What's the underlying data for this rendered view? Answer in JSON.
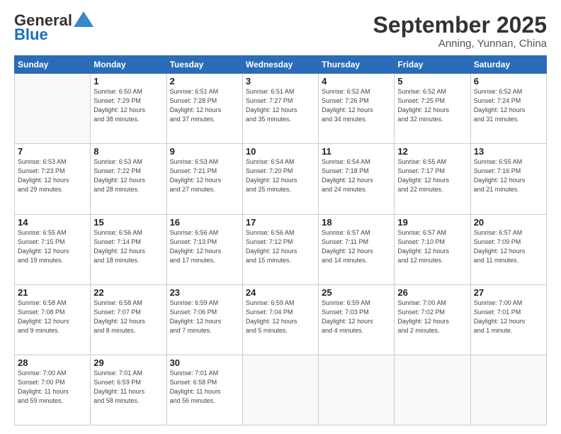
{
  "header": {
    "logo_general": "General",
    "logo_blue": "Blue",
    "month_title": "September 2025",
    "location": "Anning, Yunnan, China"
  },
  "weekdays": [
    "Sunday",
    "Monday",
    "Tuesday",
    "Wednesday",
    "Thursday",
    "Friday",
    "Saturday"
  ],
  "weeks": [
    [
      {
        "day": "",
        "info": ""
      },
      {
        "day": "1",
        "info": "Sunrise: 6:50 AM\nSunset: 7:29 PM\nDaylight: 12 hours\nand 38 minutes."
      },
      {
        "day": "2",
        "info": "Sunrise: 6:51 AM\nSunset: 7:28 PM\nDaylight: 12 hours\nand 37 minutes."
      },
      {
        "day": "3",
        "info": "Sunrise: 6:51 AM\nSunset: 7:27 PM\nDaylight: 12 hours\nand 35 minutes."
      },
      {
        "day": "4",
        "info": "Sunrise: 6:52 AM\nSunset: 7:26 PM\nDaylight: 12 hours\nand 34 minutes."
      },
      {
        "day": "5",
        "info": "Sunrise: 6:52 AM\nSunset: 7:25 PM\nDaylight: 12 hours\nand 32 minutes."
      },
      {
        "day": "6",
        "info": "Sunrise: 6:52 AM\nSunset: 7:24 PM\nDaylight: 12 hours\nand 31 minutes."
      }
    ],
    [
      {
        "day": "7",
        "info": "Sunrise: 6:53 AM\nSunset: 7:23 PM\nDaylight: 12 hours\nand 29 minutes."
      },
      {
        "day": "8",
        "info": "Sunrise: 6:53 AM\nSunset: 7:22 PM\nDaylight: 12 hours\nand 28 minutes."
      },
      {
        "day": "9",
        "info": "Sunrise: 6:53 AM\nSunset: 7:21 PM\nDaylight: 12 hours\nand 27 minutes."
      },
      {
        "day": "10",
        "info": "Sunrise: 6:54 AM\nSunset: 7:20 PM\nDaylight: 12 hours\nand 25 minutes."
      },
      {
        "day": "11",
        "info": "Sunrise: 6:54 AM\nSunset: 7:18 PM\nDaylight: 12 hours\nand 24 minutes."
      },
      {
        "day": "12",
        "info": "Sunrise: 6:55 AM\nSunset: 7:17 PM\nDaylight: 12 hours\nand 22 minutes."
      },
      {
        "day": "13",
        "info": "Sunrise: 6:55 AM\nSunset: 7:16 PM\nDaylight: 12 hours\nand 21 minutes."
      }
    ],
    [
      {
        "day": "14",
        "info": "Sunrise: 6:55 AM\nSunset: 7:15 PM\nDaylight: 12 hours\nand 19 minutes."
      },
      {
        "day": "15",
        "info": "Sunrise: 6:56 AM\nSunset: 7:14 PM\nDaylight: 12 hours\nand 18 minutes."
      },
      {
        "day": "16",
        "info": "Sunrise: 6:56 AM\nSunset: 7:13 PM\nDaylight: 12 hours\nand 17 minutes."
      },
      {
        "day": "17",
        "info": "Sunrise: 6:56 AM\nSunset: 7:12 PM\nDaylight: 12 hours\nand 15 minutes."
      },
      {
        "day": "18",
        "info": "Sunrise: 6:57 AM\nSunset: 7:11 PM\nDaylight: 12 hours\nand 14 minutes."
      },
      {
        "day": "19",
        "info": "Sunrise: 6:57 AM\nSunset: 7:10 PM\nDaylight: 12 hours\nand 12 minutes."
      },
      {
        "day": "20",
        "info": "Sunrise: 6:57 AM\nSunset: 7:09 PM\nDaylight: 12 hours\nand 11 minutes."
      }
    ],
    [
      {
        "day": "21",
        "info": "Sunrise: 6:58 AM\nSunset: 7:08 PM\nDaylight: 12 hours\nand 9 minutes."
      },
      {
        "day": "22",
        "info": "Sunrise: 6:58 AM\nSunset: 7:07 PM\nDaylight: 12 hours\nand 8 minutes."
      },
      {
        "day": "23",
        "info": "Sunrise: 6:59 AM\nSunset: 7:06 PM\nDaylight: 12 hours\nand 7 minutes."
      },
      {
        "day": "24",
        "info": "Sunrise: 6:59 AM\nSunset: 7:04 PM\nDaylight: 12 hours\nand 5 minutes."
      },
      {
        "day": "25",
        "info": "Sunrise: 6:59 AM\nSunset: 7:03 PM\nDaylight: 12 hours\nand 4 minutes."
      },
      {
        "day": "26",
        "info": "Sunrise: 7:00 AM\nSunset: 7:02 PM\nDaylight: 12 hours\nand 2 minutes."
      },
      {
        "day": "27",
        "info": "Sunrise: 7:00 AM\nSunset: 7:01 PM\nDaylight: 12 hours\nand 1 minute."
      }
    ],
    [
      {
        "day": "28",
        "info": "Sunrise: 7:00 AM\nSunset: 7:00 PM\nDaylight: 11 hours\nand 59 minutes."
      },
      {
        "day": "29",
        "info": "Sunrise: 7:01 AM\nSunset: 6:59 PM\nDaylight: 11 hours\nand 58 minutes."
      },
      {
        "day": "30",
        "info": "Sunrise: 7:01 AM\nSunset: 6:58 PM\nDaylight: 11 hours\nand 56 minutes."
      },
      {
        "day": "",
        "info": ""
      },
      {
        "day": "",
        "info": ""
      },
      {
        "day": "",
        "info": ""
      },
      {
        "day": "",
        "info": ""
      }
    ]
  ]
}
